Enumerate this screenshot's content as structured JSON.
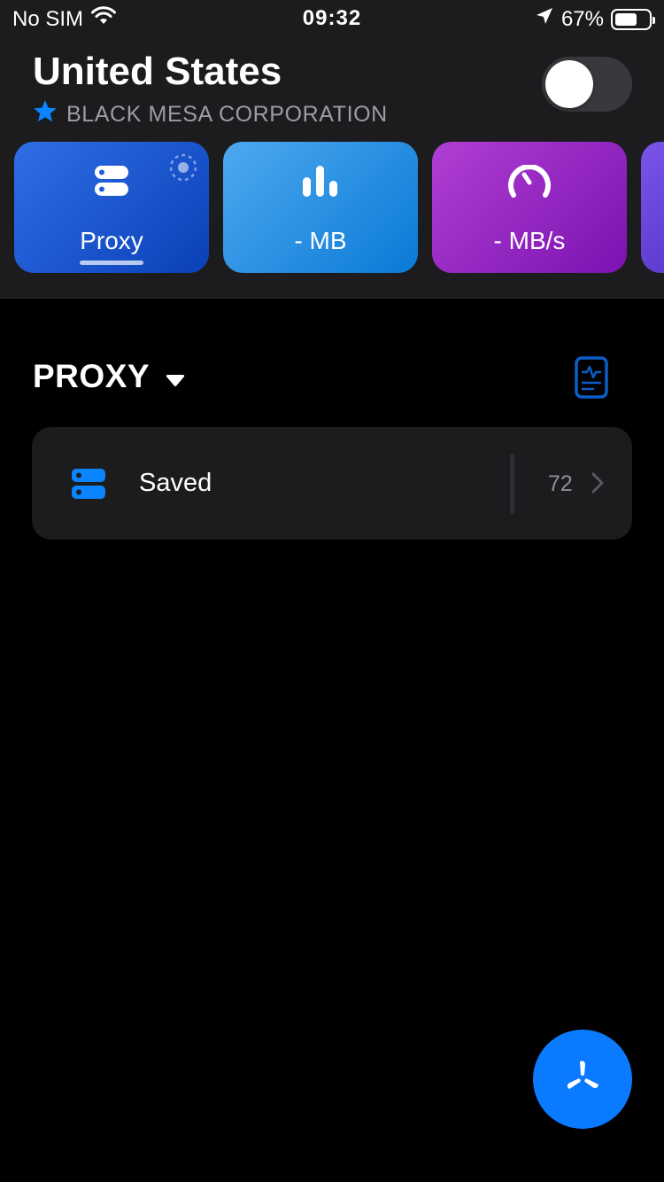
{
  "status_bar": {
    "carrier": "No SIM",
    "time": "09:32",
    "battery_percent": "67%",
    "battery_level": 0.67,
    "icons": [
      "wifi-icon",
      "location-arrow-icon",
      "battery-icon"
    ]
  },
  "header": {
    "title": "United States",
    "subtitle": "BLACK MESA CORPORATION",
    "toggle_on": false,
    "accent": "#0a7aff"
  },
  "cards": [
    {
      "label": "Proxy",
      "icon": "server-icon",
      "selected": true,
      "color": "#1f5fd6"
    },
    {
      "label": "- MB",
      "icon": "bar-chart-icon",
      "color": "#2b94e6"
    },
    {
      "label": "- MB/s",
      "icon": "speedometer-icon",
      "color": "#9a2bc8"
    },
    {
      "label": "",
      "icon": "",
      "color": "#6a47de"
    }
  ],
  "section": {
    "title": "PROXY",
    "dropdown_icon": "caret-down-icon",
    "action_icon": "document-activity-icon"
  },
  "rows": [
    {
      "label": "Saved",
      "count": "72",
      "icon": "server-icon"
    }
  ],
  "fab": {
    "icon": "fan-icon",
    "color": "#0a7aff"
  }
}
